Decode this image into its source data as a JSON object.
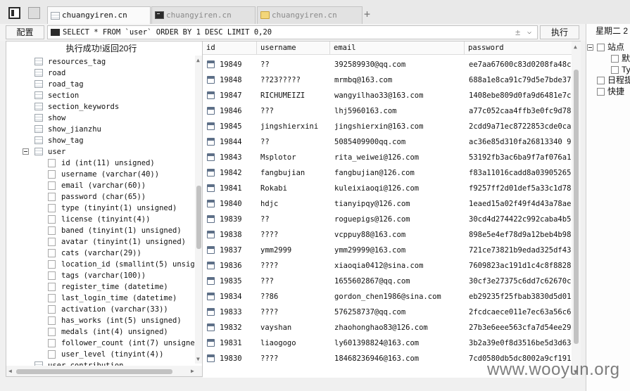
{
  "tabs": [
    {
      "label": "chuangyiren.cn",
      "icon": "table-icon",
      "active": true
    },
    {
      "label": "chuangyiren.cn",
      "icon": "terminal-icon",
      "active": false
    },
    {
      "label": "chuangyiren.cn",
      "icon": "folder-icon",
      "active": false
    }
  ],
  "new_tab_label": "+",
  "toolbar": {
    "config_label": "配置",
    "sql_query": "SELECT * FROM `user` ORDER BY 1 DESC LIMIT 0,20",
    "plusminus": "±",
    "dropdown": "⌵",
    "execute_label": "执行"
  },
  "tree": {
    "status": "执行成功!返回20行",
    "tables_before": [
      "resources_tag",
      "road",
      "road_tag",
      "section",
      "section_keywords",
      "show",
      "show_jianzhu",
      "show_tag"
    ],
    "expanded_table": "user",
    "columns": [
      "id (int(11) unsigned)",
      "username (varchar(40))",
      "email (varchar(60))",
      "password (char(65))",
      "type (tinyint(1) unsigned)",
      "license (tinyint(4))",
      "baned (tinyint(1) unsigned)",
      "avatar (tinyint(1) unsigned)",
      "cats (varchar(29))",
      "location_id (smallint(5) unsign",
      "tags (varchar(100))",
      "register_time (datetime)",
      "last_login_time (datetime)",
      "activation (varchar(33))",
      "has_works (int(5) unsigned)",
      "medals (int(4) unsigned)",
      "follower_count (int(7) unsigned",
      "user_level (tinyint(4))"
    ],
    "tables_after": [
      "user_contribution"
    ]
  },
  "grid": {
    "headers": [
      "id",
      "username",
      "email",
      "password"
    ],
    "rows": [
      [
        "19849",
        "??",
        "392589930@qq.com",
        "ee7aa67600c83d0208fa48c2"
      ],
      [
        "19848",
        "??23?????",
        "mrmbq@163.com",
        "688a1e8ca91c79d5e7bde37b"
      ],
      [
        "19847",
        "RICHUMEIZI",
        "wangyilhao33@163.com",
        "1408ebe809d0fa9d6481e7c2"
      ],
      [
        "19846",
        "???",
        "lhj5960163.com",
        "a77c052caa4ffb3e0fc9d78b"
      ],
      [
        "19845",
        "jingshierxini",
        "jingshierxin@163.com",
        "2cdd9a71ec8722853cde0ca1"
      ],
      [
        "19844",
        "??",
        "5085409900qq.com",
        "ac36e85d310fa26813340 9f8"
      ],
      [
        "19843",
        "Msplotor",
        "rita_weiwei@126.com",
        "53192fb3ac6ba9f7af076a1e"
      ],
      [
        "19842",
        "fangbujian",
        "fangbujian@126.com",
        "f83a11016cadd8a039052659"
      ],
      [
        "19841",
        "Rokabi",
        "kuleixiaoqi@126.com",
        "f9257ff2d01def5a33c1d78"
      ],
      [
        "19840",
        "hdjc",
        "tianyipqy@126.com",
        "1eaed15a02f49f4d43a78ae9"
      ],
      [
        "19839",
        "??",
        "roguepigs@126.com",
        "30cd4d274422c992caba4b57"
      ],
      [
        "19838",
        "????",
        "vcppuy88@163.com",
        "898e5e4ef78d9a12beb4b982"
      ],
      [
        "19837",
        "ymm2999",
        "ymm29999@163.com",
        "721ce73821b9edad325df43d"
      ],
      [
        "19836",
        "????",
        "xiaoqia0412@sina.com",
        "7609823ac191d1c4c8f88286"
      ],
      [
        "19835",
        "???",
        "1655602867@qq.com",
        "30cf3e27375c6dd7c62670cc"
      ],
      [
        "19834",
        "??86",
        "gordon_chen1986@sina.com",
        "eb29235f25fbab3830d5d016"
      ],
      [
        "19833",
        "????",
        "576258737@qq.com",
        "2fcdcaece011e7ec63a56c67"
      ],
      [
        "19832",
        "vayshan",
        "zhaohonghao83@126.com",
        "27b3e6eee563cfa7d54ee290"
      ],
      [
        "19831",
        "liaogogo",
        "ly601398824@163.com",
        "3b2a39e0f8d3516be5d3d634"
      ],
      [
        "19830",
        "????",
        "18468236946@163.com",
        "7cd0580db5dc8002a9cf191f"
      ]
    ]
  },
  "right_panel": {
    "weekday": "星期二 2",
    "items": [
      {
        "label": "站点",
        "level": 0,
        "icon": "site-icon"
      },
      {
        "label": "默",
        "level": 1,
        "icon": "doc-icon"
      },
      {
        "label": "Ty",
        "level": 1,
        "icon": "doc-icon"
      },
      {
        "label": "日程提",
        "level": 0,
        "icon": "calendar-icon"
      },
      {
        "label": "快捷",
        "level": 0,
        "icon": "shortcut-icon"
      }
    ]
  },
  "watermark": "www.wooyun.org"
}
